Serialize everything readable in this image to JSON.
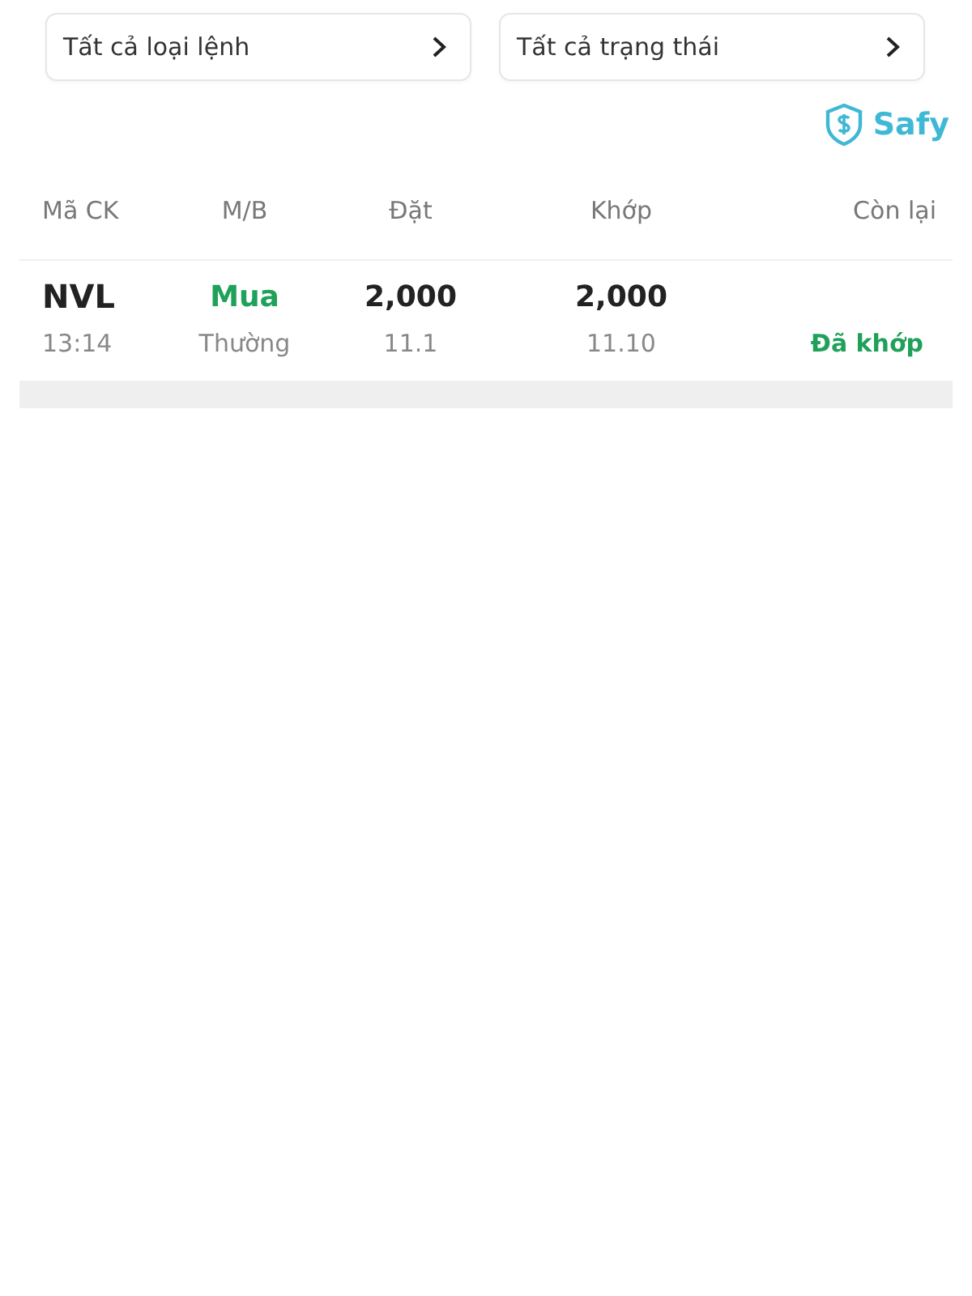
{
  "filters": [
    {
      "label": "Tất cả loại lệnh"
    },
    {
      "label": "Tất cả trạng thái"
    }
  ],
  "brand": {
    "name": "Safy"
  },
  "table": {
    "columns": [
      "Mã CK",
      "M/B",
      "Đặt",
      "Khớp",
      "Còn lại"
    ],
    "rows": [
      {
        "symbol": "NVL",
        "time": "13:14",
        "side": "Mua",
        "kind": "buy",
        "order_type": "Thường",
        "order_qty": "2,000",
        "order_price": "11.1",
        "match_qty": "2,000",
        "match_price": "11.10",
        "status": "Đã khớp"
      }
    ]
  }
}
